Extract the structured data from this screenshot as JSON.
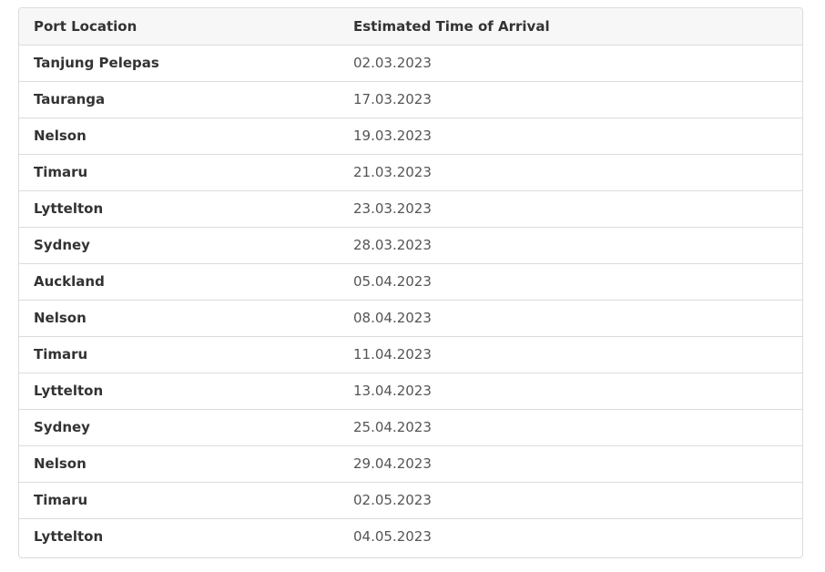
{
  "table": {
    "headers": [
      "Port Location",
      "Estimated Time of Arrival"
    ],
    "rows": [
      {
        "port": "Tanjung Pelepas",
        "eta": "02.03.2023"
      },
      {
        "port": "Tauranga",
        "eta": "17.03.2023"
      },
      {
        "port": "Nelson",
        "eta": "19.03.2023"
      },
      {
        "port": "Timaru",
        "eta": "21.03.2023"
      },
      {
        "port": "Lyttelton",
        "eta": "23.03.2023"
      },
      {
        "port": "Sydney",
        "eta": "28.03.2023"
      },
      {
        "port": "Auckland",
        "eta": "05.04.2023"
      },
      {
        "port": "Nelson",
        "eta": "08.04.2023"
      },
      {
        "port": "Timaru",
        "eta": "11.04.2023"
      },
      {
        "port": "Lyttelton",
        "eta": "13.04.2023"
      },
      {
        "port": "Sydney",
        "eta": "25.04.2023"
      },
      {
        "port": "Nelson",
        "eta": "29.04.2023"
      },
      {
        "port": "Timaru",
        "eta": "02.05.2023"
      },
      {
        "port": "Lyttelton",
        "eta": "04.05.2023"
      }
    ]
  }
}
